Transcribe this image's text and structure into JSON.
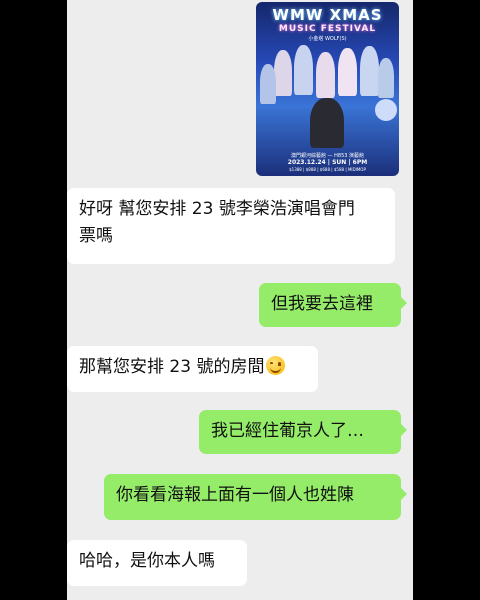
{
  "poster": {
    "title_line1": "WMW XMAS",
    "title_line2": "MUSIC FESTIVAL",
    "subtitle": "小金塔 WOLF(S)",
    "venue": "澳門銀河綜藝館 — H853 演藝館",
    "date": "2023.12.24 | SUN | 6PM",
    "price": "$1388 | $888 | $688 | $588 | MIDIMOP"
  },
  "messages": [
    {
      "side": "left",
      "text_line1": "好呀 幫您安排 23 號李榮浩演唱會門",
      "text_line2": "票嗎"
    },
    {
      "side": "right",
      "text": "但我要去這裡"
    },
    {
      "side": "left",
      "text": "那幫您安排 23 號的房間",
      "emoji": "smiling-face-emoji"
    },
    {
      "side": "right",
      "text": "我已經住葡京人了…"
    },
    {
      "side": "right",
      "text": "你看看海報上面有一個人也姓陳"
    },
    {
      "side": "left",
      "text": "哈哈，是你本人嗎"
    }
  ]
}
